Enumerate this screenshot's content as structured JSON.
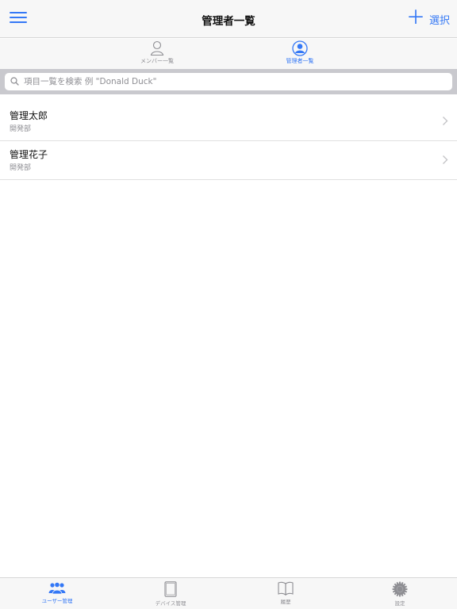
{
  "navbar": {
    "title": "管理者一覧",
    "menu_icon": "hamburger-menu-icon",
    "add_label": "＋",
    "select_label": "選択"
  },
  "segments": [
    {
      "label": "メンバー一覧",
      "icon": "person-outline-icon",
      "selected": false
    },
    {
      "label": "管理者一覧",
      "icon": "person-circle-icon",
      "selected": true
    }
  ],
  "search": {
    "placeholder": "項目一覧を検索 例 \"Donald Duck\"",
    "value": ""
  },
  "rows": [
    {
      "name": "管理太郎",
      "department": "開発部"
    },
    {
      "name": "管理花子",
      "department": "開発部"
    }
  ],
  "tabs": [
    {
      "label": "ユーザー管理",
      "icon": "users-group-icon",
      "selected": true
    },
    {
      "label": "デバイス管理",
      "icon": "tablet-icon",
      "selected": false
    },
    {
      "label": "履歴",
      "icon": "book-icon",
      "selected": false
    },
    {
      "label": "設定",
      "icon": "gear-icon",
      "selected": false
    }
  ],
  "colors": {
    "accent": "#3478f6",
    "inactive": "#8e8e93",
    "bar_background": "#f7f7f7",
    "search_background": "#c9c9ce"
  }
}
